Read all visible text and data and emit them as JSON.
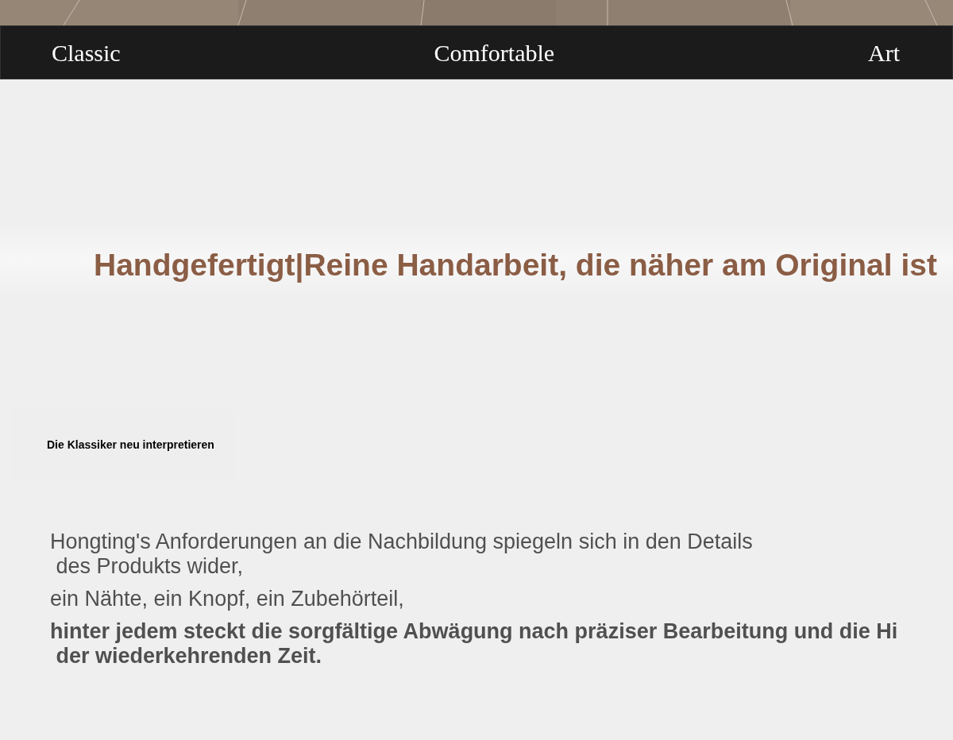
{
  "nav": {
    "items": [
      "Classic",
      "Comfortable",
      "Art"
    ]
  },
  "headline": "Handgefertigt|Reine Handarbeit, die näher am Original ist",
  "tagline": "Die Klassiker neu interpretieren",
  "paragraphs": [
    {
      "lines": [
        "Hongting's Anforderungen an die Nachbildung spiegeln sich in den Details",
        " des Produkts wider,"
      ],
      "bold": false
    },
    {
      "lines": [
        "ein Nähte, ein Knopf, ein Zubehörteil,"
      ],
      "bold": false
    },
    {
      "lines": [
        "hinter jedem steckt die sorgfältige Abwägung nach präziser Bearbeitung und die Hi",
        " der wiederkehrenden Zeit."
      ],
      "bold": true
    }
  ]
}
